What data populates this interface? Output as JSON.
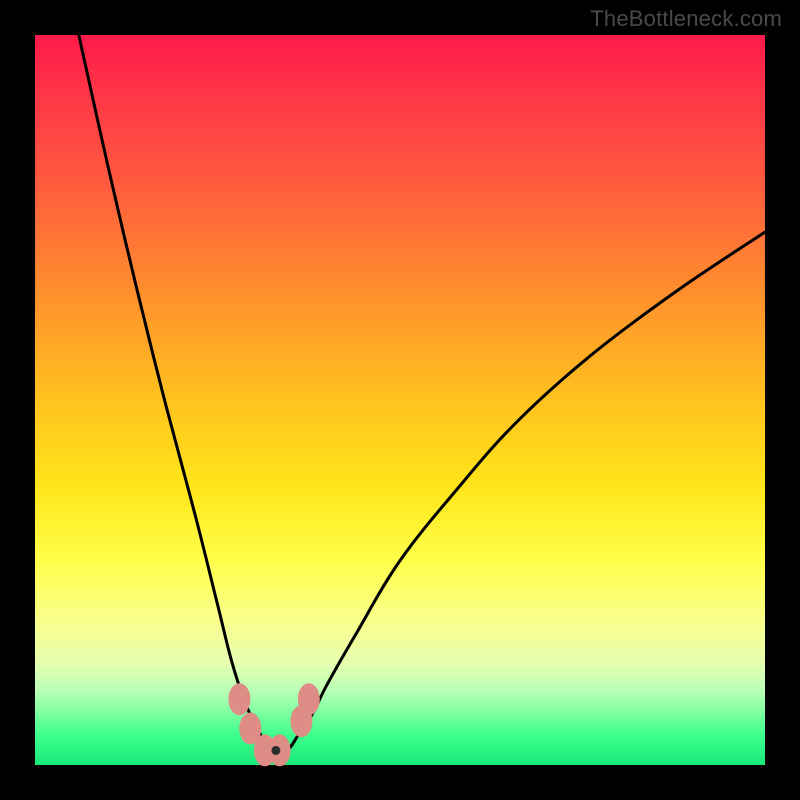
{
  "watermark": "TheBottleneck.com",
  "colors": {
    "background": "#000000",
    "curve": "#000000",
    "marker_fill": "#dd8d86",
    "marker_dot": "#2a2f2b",
    "gradient_top": "#ff1a4a",
    "gradient_bottom": "#18e87a"
  },
  "chart_data": {
    "type": "line",
    "title": "",
    "xlabel": "",
    "ylabel": "",
    "xlim": [
      0,
      100
    ],
    "ylim": [
      0,
      100
    ],
    "legend": false,
    "grid": false,
    "annotations": [],
    "series": [
      {
        "name": "bottleneck-curve",
        "x": [
          6,
          10,
          14,
          18,
          22,
          25,
          27,
          29,
          31,
          32.5,
          34.5,
          36,
          38,
          40,
          44,
          50,
          58,
          66,
          76,
          88,
          100
        ],
        "y": [
          100,
          82,
          65,
          49,
          34,
          22,
          14,
          8,
          4,
          2,
          2,
          4,
          7,
          11,
          18,
          28,
          38,
          47,
          56,
          65,
          73
        ]
      }
    ],
    "markers": [
      {
        "name": "left-lobe-top",
        "x": 28.0,
        "y": 9.0
      },
      {
        "name": "left-lobe-mid",
        "x": 29.5,
        "y": 5.0
      },
      {
        "name": "valley-bottom-1",
        "x": 31.5,
        "y": 2.0
      },
      {
        "name": "valley-bottom-2",
        "x": 33.5,
        "y": 2.0
      },
      {
        "name": "right-lobe-start",
        "x": 36.5,
        "y": 6.0
      },
      {
        "name": "right-lobe-top",
        "x": 37.5,
        "y": 9.0
      }
    ],
    "minimum_point": {
      "x": 33.0,
      "y": 2.0,
      "dot": true
    }
  }
}
